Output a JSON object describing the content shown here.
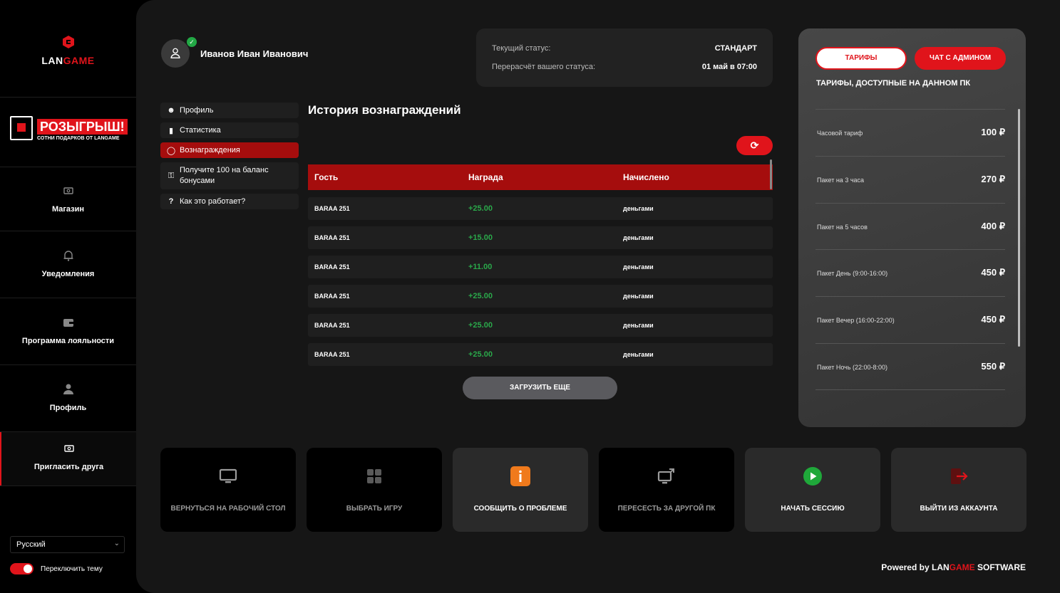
{
  "brand": {
    "logo_pre": "LAN",
    "logo_post": "GAME"
  },
  "promo": {
    "title": "РОЗЫГРЫШ!",
    "subtitle": "СОТНИ ПОДАРКОВ ОТ LANGAME"
  },
  "sidebar": {
    "items": [
      {
        "label": "Магазин",
        "icon": "shop-icon"
      },
      {
        "label": "Уведомления",
        "icon": "bell-icon"
      },
      {
        "label": "Программа лояльности",
        "icon": "wallet-icon"
      },
      {
        "label": "Профиль",
        "icon": "user-icon"
      },
      {
        "label": "Пригласить друга",
        "icon": "invite-icon"
      }
    ],
    "language": "Русский",
    "theme_toggle_label": "Переключить тему"
  },
  "user": {
    "name": "Иванов Иван Иванович"
  },
  "status": {
    "current_label": "Текущий статус:",
    "current_value": "СТАНДАРТ",
    "recalc_label": "Перерасчёт вашего статуса:",
    "recalc_value": "01 май в 07:00"
  },
  "menu": [
    {
      "label": "Профиль",
      "icon": "user-icon"
    },
    {
      "label": "Статистика",
      "icon": "chart-icon"
    },
    {
      "label": "Вознаграждения",
      "icon": "bag-icon"
    },
    {
      "label": "Получите 100 на баланс бонусами",
      "icon": "key-icon"
    },
    {
      "label": "Как это работает?",
      "icon": "question-icon"
    }
  ],
  "history": {
    "title": "История вознаграждений",
    "columns": [
      "Гость",
      "Награда",
      "Начислено"
    ],
    "rows": [
      {
        "guest": "BARAA 251",
        "reward": "+25.00",
        "type": "деньгами"
      },
      {
        "guest": "BARAA 251",
        "reward": "+15.00",
        "type": "деньгами"
      },
      {
        "guest": "BARAA 251",
        "reward": "+11.00",
        "type": "деньгами"
      },
      {
        "guest": "BARAA 251",
        "reward": "+25.00",
        "type": "деньгами"
      },
      {
        "guest": "BARAA 251",
        "reward": "+25.00",
        "type": "деньгами"
      },
      {
        "guest": "BARAA 251",
        "reward": "+25.00",
        "type": "деньгами"
      }
    ],
    "load_more": "ЗАГРУЗИТЬ ЕЩЕ"
  },
  "tariffs": {
    "tab_tariffs": "ТАРИФЫ",
    "tab_chat": "ЧАТ С АДМИНОМ",
    "subtitle": "ТАРИФЫ, ДОСТУПНЫЕ НА ДАННОМ ПК",
    "items": [
      {
        "name": "Часовой тариф",
        "price": "100 ₽"
      },
      {
        "name": "Пакет на 3 часа",
        "price": "270 ₽"
      },
      {
        "name": "Пакет на 5 часов",
        "price": "400 ₽"
      },
      {
        "name": "Пакет День (9:00-16:00)",
        "price": "450 ₽"
      },
      {
        "name": "Пакет Вечер (16:00-22:00)",
        "price": "450 ₽"
      },
      {
        "name": "Пакет Ночь (22:00-8:00)",
        "price": "550 ₽"
      }
    ]
  },
  "actions": [
    {
      "label": "ВЕРНУТЬСЯ НА РАБОЧИЙ СТОЛ",
      "icon": "monitor-icon"
    },
    {
      "label": "ВЫБРАТЬ ИГРУ",
      "icon": "grid-icon"
    },
    {
      "label": "СООБЩИТЬ О ПРОБЛЕМЕ",
      "icon": "info-icon"
    },
    {
      "label": "ПЕРЕСЕСТЬ ЗА ДРУГОЙ ПК",
      "icon": "switch-pc-icon"
    },
    {
      "label": "НАЧАТЬ СЕССИЮ",
      "icon": "play-icon"
    },
    {
      "label": "ВЫЙТИ ИЗ АККАУНТА",
      "icon": "logout-icon"
    }
  ],
  "footer": {
    "powered_pre": "Powered by",
    "brand_pre": "LAN",
    "brand_mid": "GAME",
    "brand_post": "SOFTWARE"
  },
  "colors": {
    "accent": "#e0141b",
    "dark_red": "#a50d0d",
    "positive": "#2aa84a",
    "background": "#161616"
  }
}
